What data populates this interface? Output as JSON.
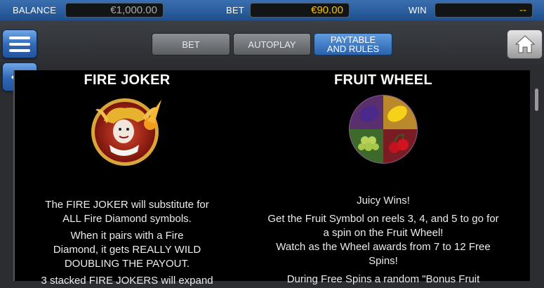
{
  "status_bar": {
    "balance_label": "BALANCE",
    "balance_value": "€1,000.00",
    "bet_label": "BET",
    "bet_value": "€90.00",
    "win_label": "WIN",
    "win_value": "--"
  },
  "tabs": [
    {
      "label": "BET"
    },
    {
      "label": "AUTOPLAY"
    },
    {
      "label": "PAYTABLE\nAND RULES"
    }
  ],
  "icons": {
    "menu": "hamburger-menu-icon",
    "back": "arrow-left-icon",
    "home": "home-icon"
  },
  "colors": {
    "accent_blue": "#2f66b5",
    "value_yellow": "#f5c400",
    "panel_bg": "#000000"
  },
  "fire_joker": {
    "title": "FIRE JOKER",
    "p1": "The FIRE JOKER will substitute for ALL Fire Diamond symbols.",
    "p2": "When it pairs with a Fire Diamond, it gets REALLY WILD DOUBLING THE PAYOUT.",
    "p3": "3 stacked FIRE JOKERS will expand"
  },
  "fruit_wheel": {
    "title": "FRUIT WHEEL",
    "p1": "Juicy Wins!",
    "p2": "Get the Fruit Symbol on reels 3, 4, and 5 to go for a spin on the Fruit Wheel!",
    "p3": "Watch as the Wheel awards from 7 to 12 Free Spins!",
    "p4": "During Free Spins a random \"Bonus Fruit"
  }
}
